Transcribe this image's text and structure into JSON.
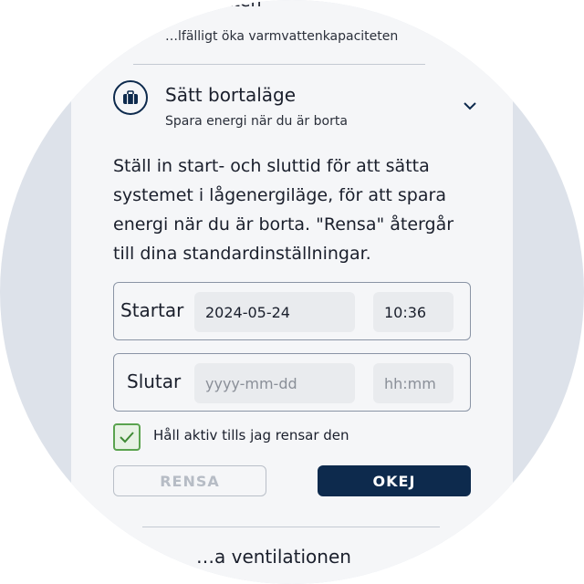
{
  "previous_section": {
    "title": "…rmvatten",
    "subtitle": "…lfälligt öka varmvattenkapaciteten"
  },
  "away_section": {
    "title": "Sätt bortaläge",
    "subtitle": "Spara energi när du är borta",
    "icon": "suitcase-icon",
    "expand_icon": "chevron-down-icon",
    "description": "Ställ in start- och sluttid för att sätta systemet i lågenergiläge, för att spara energi när du är borta. \"Rensa\" återgår till dina standardinställningar.",
    "start": {
      "label": "Startar",
      "date_value": "2024-05-24",
      "time_value": "10:36"
    },
    "end": {
      "label": "Slutar",
      "date_placeholder": "yyyy-mm-dd",
      "time_placeholder": "hh:mm",
      "date_value": "",
      "time_value": ""
    },
    "keep_active": {
      "label": "Håll aktiv tills jag rensar den",
      "checked": true
    },
    "clear_button": "RENSA",
    "ok_button": "OKEJ"
  },
  "next_section": {
    "title": "…a ventilationen"
  },
  "colors": {
    "primary": "#0d2a4d",
    "check_green": "#5aa34f",
    "panel_bg": "#f5f6f8",
    "frame_bg": "#dde2ea"
  }
}
